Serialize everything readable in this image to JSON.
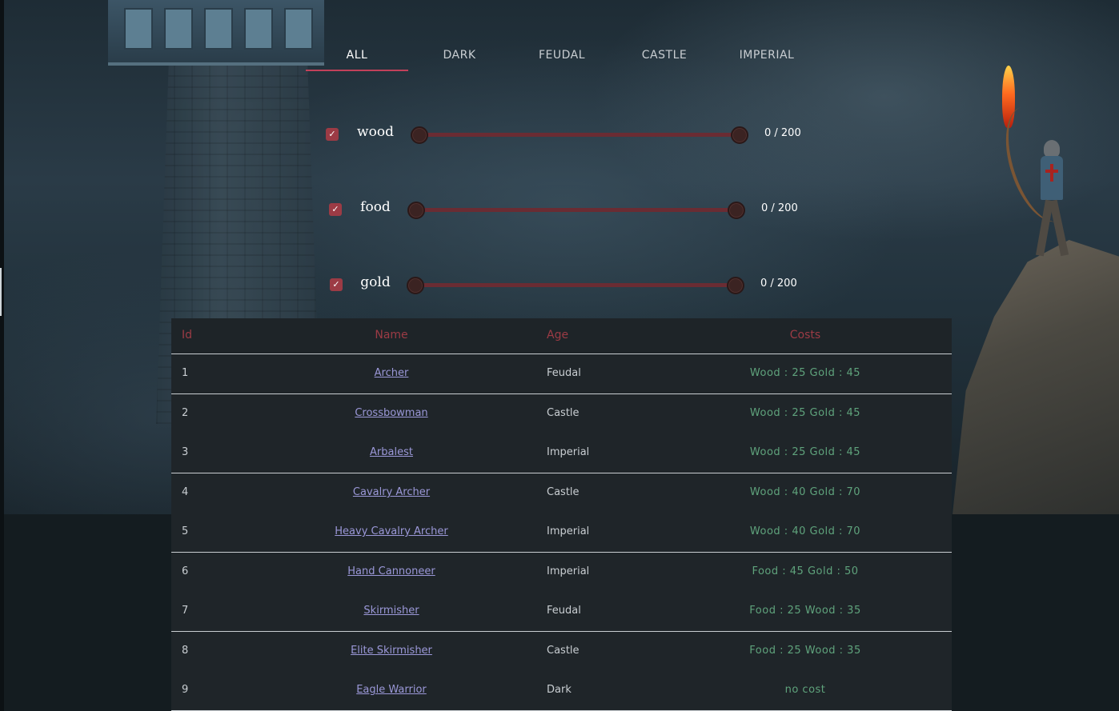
{
  "tabs": [
    {
      "label": "ALL",
      "active": true
    },
    {
      "label": "DARK",
      "active": false
    },
    {
      "label": "FEUDAL",
      "active": false
    },
    {
      "label": "CASTLE",
      "active": false
    },
    {
      "label": "IMPERIAL",
      "active": false
    }
  ],
  "filters": [
    {
      "resource": "wood",
      "checked": true,
      "range": "0 / 200",
      "min": 0,
      "max": 200
    },
    {
      "resource": "food",
      "checked": true,
      "range": "0 / 200",
      "min": 0,
      "max": 200
    },
    {
      "resource": "gold",
      "checked": true,
      "range": "0 / 200",
      "min": 0,
      "max": 200
    }
  ],
  "table": {
    "headers": {
      "id": "Id",
      "name": "Name",
      "age": "Age",
      "costs": "Costs"
    },
    "rows": [
      {
        "id": "1",
        "name": "Archer",
        "age": "Feudal",
        "costs": "Wood : 25 Gold : 45"
      },
      {
        "id": "2",
        "name": "Crossbowman",
        "age": "Castle",
        "costs": "Wood : 25 Gold : 45"
      },
      {
        "id": "3",
        "name": "Arbalest",
        "age": "Imperial",
        "costs": "Wood : 25 Gold : 45"
      },
      {
        "id": "4",
        "name": "Cavalry Archer",
        "age": "Castle",
        "costs": "Wood : 40 Gold : 70"
      },
      {
        "id": "5",
        "name": "Heavy Cavalry Archer",
        "age": "Imperial",
        "costs": "Wood : 40 Gold : 70"
      },
      {
        "id": "6",
        "name": "Hand Cannoneer",
        "age": "Imperial",
        "costs": "Food : 45 Gold : 50"
      },
      {
        "id": "7",
        "name": "Skirmisher",
        "age": "Feudal",
        "costs": "Food : 25 Wood : 35"
      },
      {
        "id": "8",
        "name": "Elite Skirmisher",
        "age": "Castle",
        "costs": "Food : 25 Wood : 35"
      },
      {
        "id": "9",
        "name": "Eagle Warrior",
        "age": "Dark",
        "costs": "no cost"
      }
    ]
  },
  "colors": {
    "accent": "#c2415a",
    "checkbox": "#9c3b45",
    "header_text": "#9c3b45",
    "link": "#9b98d8",
    "cost_text": "#5fa37c",
    "slider_track": "#6a2c33"
  },
  "icons": {
    "checkbox": "check-icon"
  }
}
